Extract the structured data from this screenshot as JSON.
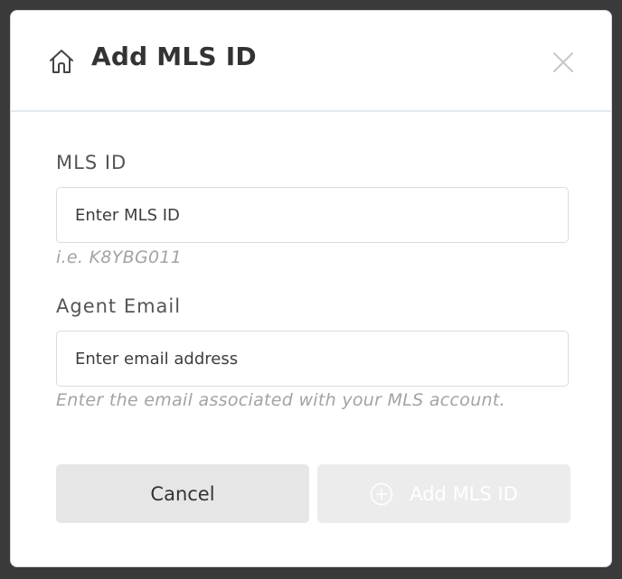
{
  "dialog": {
    "title": "Add MLS ID",
    "icon": "home-icon",
    "close_icon": "close-icon"
  },
  "form": {
    "mls_id": {
      "label": "MLS ID",
      "placeholder": "Enter MLS ID",
      "value": "",
      "hint": "i.e. K8YBG011"
    },
    "agent_email": {
      "label": "Agent Email",
      "placeholder": "Enter email address",
      "value": "",
      "hint": "Enter the email associated with your MLS account."
    }
  },
  "actions": {
    "cancel_label": "Cancel",
    "add_label": "Add MLS ID",
    "add_icon": "plus-circle-icon",
    "add_disabled": true
  },
  "colors": {
    "overlay": "#3a3a3a",
    "divider": "#e4e9f0",
    "hint": "#a3a3a3",
    "cancel_bg": "#e6e6e6",
    "add_bg_disabled": "#ececec"
  }
}
